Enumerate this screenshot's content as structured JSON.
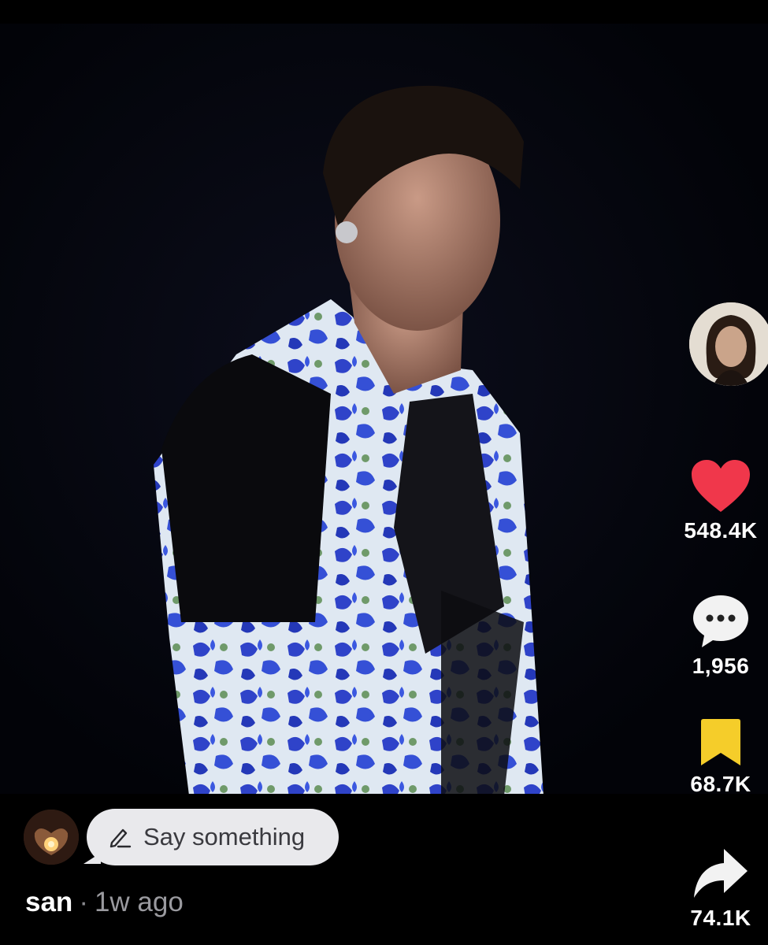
{
  "post": {
    "creator_avatar_icon": "creator-avatar",
    "actions": {
      "like": {
        "icon": "heart-icon",
        "count": "548.4K",
        "color": "#f0374b"
      },
      "comment": {
        "icon": "comment-bubble-icon",
        "count": "1,956"
      },
      "save": {
        "icon": "bookmark-icon",
        "count": "68.7K",
        "color": "#f5cd2a"
      },
      "share": {
        "icon": "share-arrow-icon",
        "count": "74.1K"
      }
    }
  },
  "comment_bar": {
    "user_avatar_icon": "user-avatar",
    "pencil_icon": "pencil-icon",
    "placeholder": "Say something"
  },
  "author_line": {
    "username": "san",
    "separator": "·",
    "time": "1w ago"
  }
}
